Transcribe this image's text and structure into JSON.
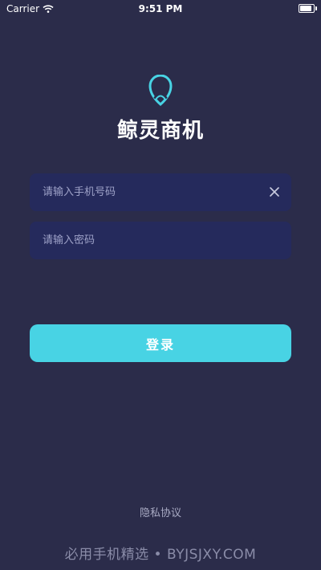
{
  "status_bar": {
    "carrier": "Carrier",
    "time": "9:51 PM",
    "battery_level": 0.85,
    "icons": [
      "wifi-icon",
      "battery-icon"
    ]
  },
  "app": {
    "logo_icon": "whale-drop-logo-icon",
    "name": "鲸灵商机"
  },
  "form": {
    "phone": {
      "value": "",
      "placeholder": "请输入手机号码",
      "clear_icon": "close-icon"
    },
    "password": {
      "value": "",
      "placeholder": "请输入密码"
    },
    "login_label": "登录"
  },
  "footer": {
    "privacy_label": "隐私协议",
    "watermark": "必用手机精选 • BYJSJXY.COM"
  },
  "colors": {
    "background": "#2b2c4a",
    "field": "#252a5c",
    "accent": "#48d3e4",
    "placeholder": "#9ea2c8"
  }
}
